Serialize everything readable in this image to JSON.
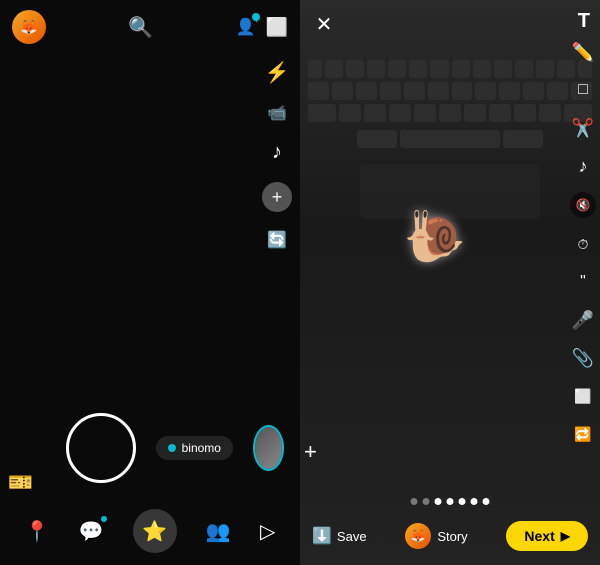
{
  "left_panel": {
    "top_bar": {
      "search_label": "🔍",
      "add_friend_label": "👤+",
      "settings_label": "⬜"
    },
    "toolbar": {
      "flash_label": "⚡",
      "video_label": "📹",
      "music_label": "♪",
      "plus_label": "+",
      "rotate_label": "🔄"
    },
    "capture": {
      "mode_text": "binomo"
    },
    "bottom_nav": {
      "map_label": "📍",
      "chat_label": "💬",
      "snap_label": "⭐",
      "friends_label": "👥",
      "discover_label": "▷"
    }
  },
  "right_panel": {
    "close_label": "✕",
    "text_tool_label": "T",
    "edit_tools": {
      "pencil": "✏️",
      "sticker": "□",
      "scissors": "✂️",
      "music": "♪",
      "mute": "🔇",
      "timer": "⏱",
      "quote": "❝",
      "mic": "🎤",
      "paperclip": "📎",
      "crop": "⬜",
      "loop": "🔁"
    },
    "dots": [
      false,
      false,
      false,
      true,
      true,
      true,
      true
    ],
    "plus_label": "+",
    "bottom_bar": {
      "save_label": "Save",
      "story_label": "Story",
      "next_label": "Next"
    }
  }
}
